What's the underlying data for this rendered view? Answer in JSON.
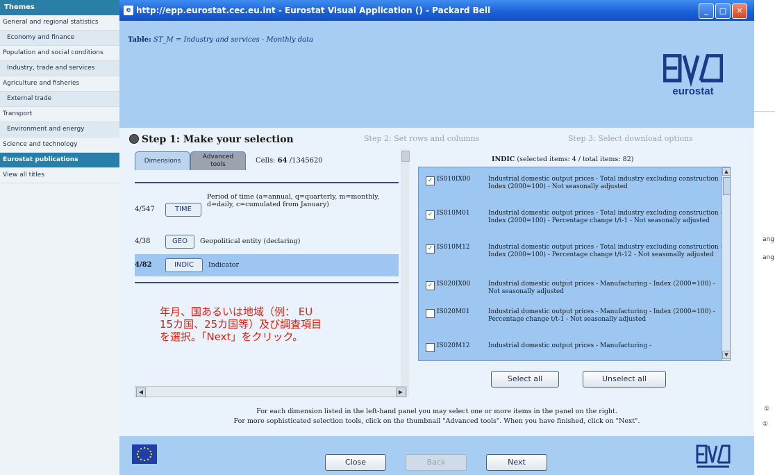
{
  "sidebar": {
    "header": "Themes",
    "items": [
      {
        "label": "General and regional statistics",
        "style": "plain"
      },
      {
        "label": "Economy and finance",
        "style": "alt"
      },
      {
        "label": "Population and social conditions",
        "style": "plain"
      },
      {
        "label": "Industry, trade and services",
        "style": "alt"
      },
      {
        "label": "Agriculture and fisheries",
        "style": "plain"
      },
      {
        "label": "External trade",
        "style": "alt"
      },
      {
        "label": "Transport",
        "style": "plain"
      },
      {
        "label": "Environment and energy",
        "style": "alt"
      },
      {
        "label": "Science and technology",
        "style": "plain"
      },
      {
        "label": "Eurostat publications",
        "style": "active"
      },
      {
        "label": "View all titles",
        "style": "plain"
      }
    ]
  },
  "background_fragments": [
    "ang",
    "ang",
    "①",
    "①"
  ],
  "window": {
    "title": "http://epp.eurostat.cec.eu.int - Eurostat Visual Application () - Packard Bell",
    "icon": "ie-page-icon",
    "controls": [
      "minimize",
      "maximize",
      "close"
    ]
  },
  "table": {
    "label": "Table:",
    "code": "ST_M",
    "description": " = Industry and services - Monthly data"
  },
  "logo": {
    "text": "eurostat",
    "color": "#1a3a8a"
  },
  "steps": {
    "step1": "Step 1: Make your selection",
    "step2": "Step 2: Set rows and columns",
    "step3": "Step 3: Select download options"
  },
  "tabs": {
    "dimensions": "Dimensions",
    "advanced_line1": "Advanced",
    "advanced_line2": "tools"
  },
  "cells": {
    "prefix": "Cells: ",
    "selected": "64",
    "total": " /1345620"
  },
  "dimensions": [
    {
      "count": "4/547",
      "code": "TIME",
      "description": "Period of time (a=annual, q=quarterly, m=monthly, d=daily, c=cumulated from January)"
    },
    {
      "count": "4/38",
      "code": "GEO",
      "description": "Geopolitical entity (declaring)"
    },
    {
      "count": "4/82",
      "code": "INDIC",
      "description": "Indicator",
      "selected": true
    }
  ],
  "japanese_note": "年月、国あるいは地域（例： EU 15カ国、25カ国等）及び調査項目を選択。「Next」をクリック。",
  "indic_panel": {
    "title": "INDIC",
    "info": " (selected items: 4 / total items: 82)",
    "items": [
      {
        "checked": true,
        "code": "IS010IX00",
        "desc": "Industrial domestic output prices - Total industry excluding construction - Index (2000=100) - Not seasonally adjusted"
      },
      {
        "checked": true,
        "code": "IS010M01",
        "desc": "Industrial domestic output prices - Total industry excluding construction - Index (2000=100) - Percentage change t/t-1 - Not seasonally adjusted"
      },
      {
        "checked": true,
        "code": "IS010M12",
        "desc": "Industrial domestic output prices - Total industry excluding construction - Index (2000=100) - Percentage change t/t-12 - Not seasonally adjusted"
      },
      {
        "checked": true,
        "code": "IS020IX00",
        "desc": "Industrial domestic output prices - Manufacturing - Index (2000=100) - Not seasonally adjusted"
      },
      {
        "checked": false,
        "code": "IS020M01",
        "desc": "Industrial domestic output prices - Manufacturing - Index (2000=100) - Percentage change t/t-1 - Not seasonally adjusted"
      },
      {
        "checked": false,
        "code": "IS020M12",
        "desc": "Industrial domestic output prices - Manufacturing -"
      }
    ],
    "select_all": "Select all",
    "unselect_all": "Unselect all"
  },
  "footer": {
    "line1": "For each dimension listed in the left-hand panel you may select one or more items in the panel on the right.",
    "line2": "For more sophisticated selection tools, click on the thumbnail \"Advanced tools\". When you have finished, click on \"Next\"."
  },
  "nav": {
    "close": "Close",
    "back": "Back",
    "next": "Next"
  }
}
